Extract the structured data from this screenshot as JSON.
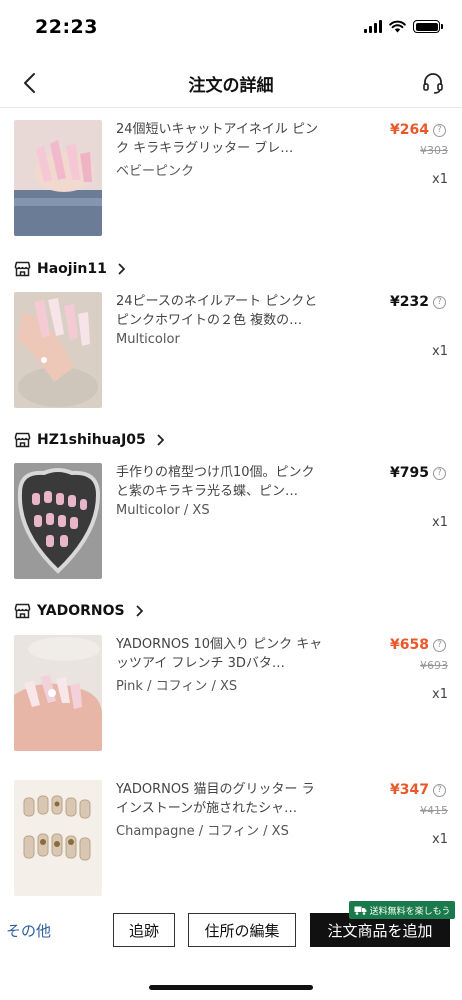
{
  "status_bar": {
    "time": "22:23"
  },
  "nav": {
    "title": "注文の詳細"
  },
  "shops": [
    {
      "name": "Haojin11"
    },
    {
      "name": "HZ1shihuaJ05"
    },
    {
      "name": "YADORNOS"
    }
  ],
  "items": [
    {
      "title": "24個短いキャットアイネイル ピンク キラキラグリッター ブレ…",
      "variant": "ベビーピンク",
      "price": "¥264",
      "original_price": "¥303",
      "qty": "x1",
      "on_sale": true
    },
    {
      "title": "24ピースのネイルアート ピンクとピンクホワイトの２色 複数の…",
      "variant": "Multicolor",
      "price": "¥232",
      "qty": "x1",
      "on_sale": false
    },
    {
      "title": "手作りの棺型つけ爪10個。ピンクと紫のキラキラ光る蝶、ピン…",
      "variant": "Multicolor / XS",
      "price": "¥795",
      "qty": "x1",
      "on_sale": false
    },
    {
      "title": "YADORNOS 10個入り ピンク キャッツアイ フレンチ 3Dバタ…",
      "variant": "Pink / コフィン / XS",
      "price": "¥658",
      "original_price": "¥693",
      "qty": "x1",
      "on_sale": true
    },
    {
      "title": "YADORNOS 猫目のグリッター ラインストーンが施されたシャ…",
      "variant": "Champagne / コフィン / XS",
      "price": "¥347",
      "original_price": "¥415",
      "qty": "x1",
      "on_sale": true
    }
  ],
  "bottom_bar": {
    "more_label": "その他",
    "track_label": "追跡",
    "edit_address_label": "住所の編集",
    "add_items_label": "注文商品を追加",
    "shipping_badge": "送料無料を楽しもう"
  },
  "colors": {
    "sale_price": "#e8582b",
    "link": "#2c5f9e",
    "badge": "#1a7a4c"
  },
  "icons": [
    "back-arrow-icon",
    "headset-icon",
    "store-icon",
    "chevron-right-icon",
    "info-icon",
    "truck-icon"
  ]
}
